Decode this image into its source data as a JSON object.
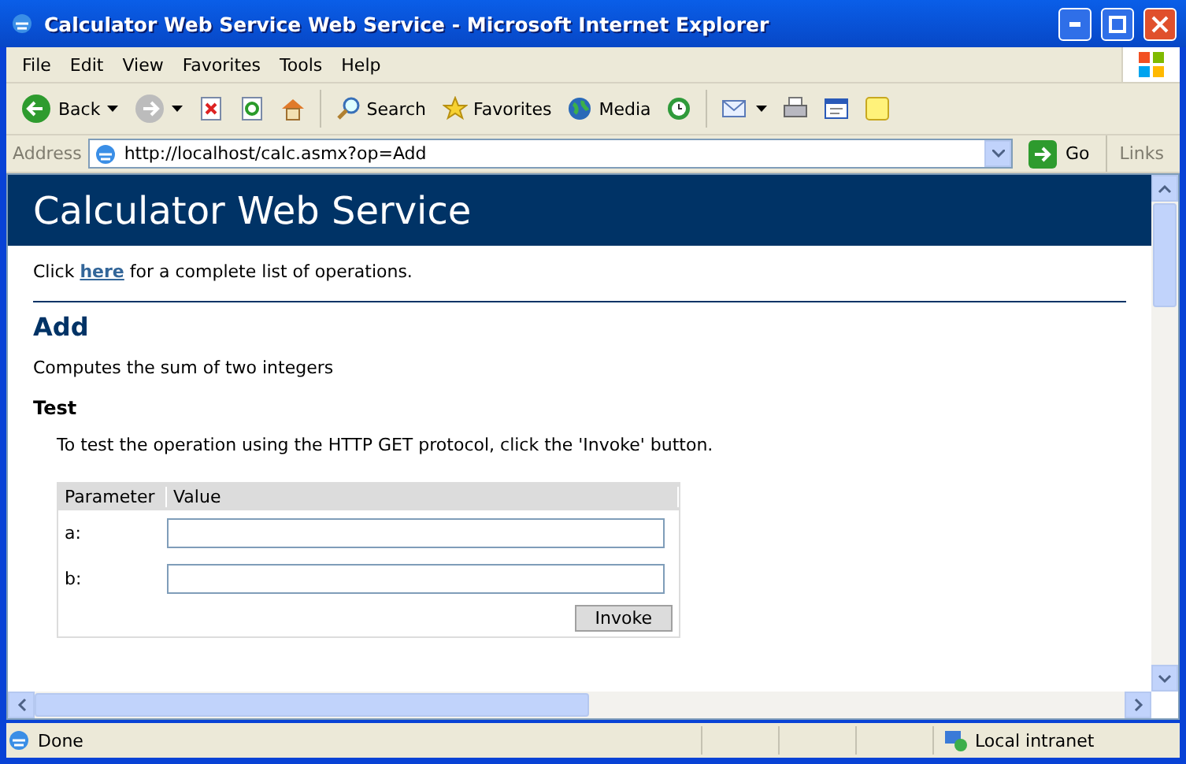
{
  "window": {
    "title": "Calculator Web Service Web Service - Microsoft Internet Explorer"
  },
  "menu": [
    "File",
    "Edit",
    "View",
    "Favorites",
    "Tools",
    "Help"
  ],
  "toolbar": [
    {
      "kind": "back",
      "label": "Back"
    },
    {
      "kind": "forward"
    },
    {
      "kind": "stop"
    },
    {
      "kind": "refresh"
    },
    {
      "kind": "home"
    },
    {
      "kind": "search",
      "label": "Search"
    },
    {
      "kind": "favorites",
      "label": "Favorites"
    },
    {
      "kind": "media",
      "label": "Media"
    },
    {
      "kind": "history"
    },
    {
      "kind": "mail"
    },
    {
      "kind": "print"
    },
    {
      "kind": "edit"
    },
    {
      "kind": "note"
    }
  ],
  "address": {
    "label": "Address",
    "url": "http://localhost/calc.asmx?op=Add",
    "go": "Go",
    "links": "Links"
  },
  "page": {
    "banner": "Calculator Web Service",
    "intro": {
      "before": "Click ",
      "link": "here",
      "after": " for a complete list of operations."
    },
    "operation": "Add",
    "description": "Computes the sum of two integers",
    "test_heading": "Test",
    "test_text": "To test the operation using the HTTP GET protocol, click the 'Invoke' button.",
    "form": {
      "columns": [
        "Parameter",
        "Value"
      ],
      "rows": [
        {
          "label": "a:"
        },
        {
          "label": "b:"
        }
      ],
      "button": "Invoke"
    }
  },
  "status_bar": {
    "text": "Done",
    "zone": "Local intranet"
  }
}
